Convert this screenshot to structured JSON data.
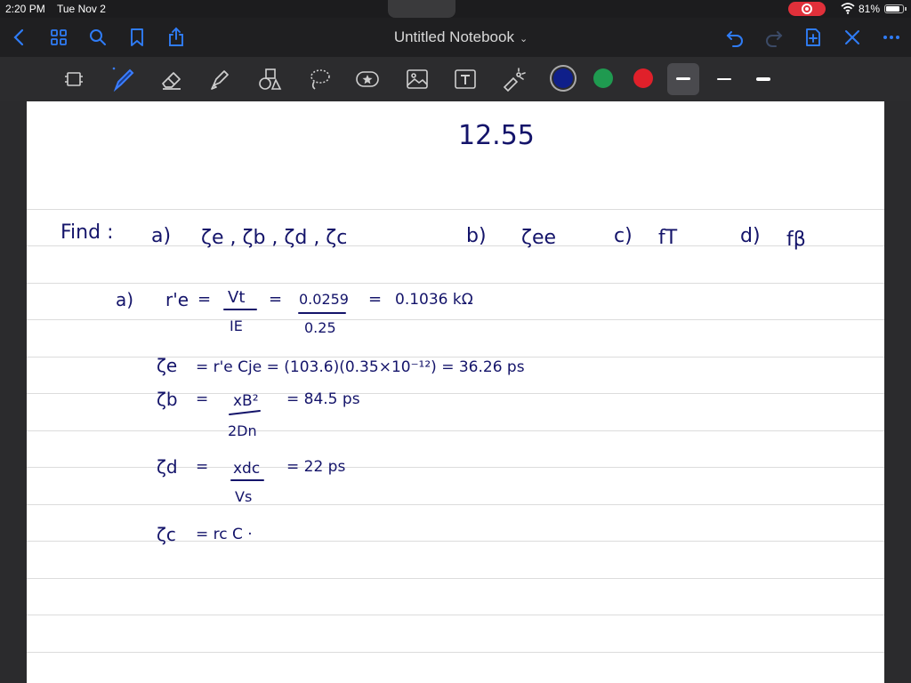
{
  "status_bar": {
    "time": "2:20 PM",
    "date": "Tue Nov 2",
    "battery_percent": "81%",
    "battery_level": 0.81
  },
  "nav_bar": {
    "title": "Untitled Notebook",
    "icons": [
      "back-icon",
      "thumbnails-icon",
      "search-icon",
      "bookmark-icon",
      "share-icon",
      "undo-icon",
      "redo-icon",
      "add-page-icon",
      "close-icon",
      "more-icon"
    ]
  },
  "toolbar": {
    "tools": [
      "lasso-page-icon",
      "pen-icon",
      "eraser-icon",
      "highlighter-icon",
      "shapes-icon",
      "lasso-icon",
      "sticker-icon",
      "image-icon",
      "text-icon",
      "laser-pointer-icon"
    ],
    "selected_tool": "pen-icon",
    "colors": [
      "#0f1f8a",
      "#1f9a50",
      "#e0202a"
    ],
    "selected_color": "#0f1f8a"
  },
  "notes": {
    "problem_number": "12.55",
    "find_label": "Find :",
    "find_a_label": "a)",
    "find_a_items": "ζe , ζb , ζd , ζc",
    "find_b_label": "b)",
    "find_b_item": "ζee",
    "find_c_label": "c)",
    "find_c_item": "fT",
    "find_d_label": "d)",
    "find_d_item": "fβ",
    "part_a_label": "a)",
    "re_lhs": "r'e",
    "re_eq": "=",
    "re_num": "Vt",
    "re_den": "IE",
    "re_eq2": "=",
    "re_num2": "0.0259",
    "re_den2": "0.25",
    "re_eq3": "=",
    "re_result": "0.1036 kΩ",
    "tau_e_lhs": "ζe",
    "tau_e_rhs": "= r'e Cje = (103.6)(0.35×10⁻¹²) = 36.26 ps",
    "tau_b_lhs": "ζb",
    "tau_b_num": "xB²",
    "tau_b_den": "2Dn",
    "tau_b_result": "= 84.5 ps",
    "tau_d_lhs": "ζd",
    "tau_d_num": "xdc",
    "tau_d_den": "Vs",
    "tau_d_result": "= 22 ps",
    "tau_c_lhs": "ζc",
    "tau_c_rhs": "= rc C ·"
  }
}
